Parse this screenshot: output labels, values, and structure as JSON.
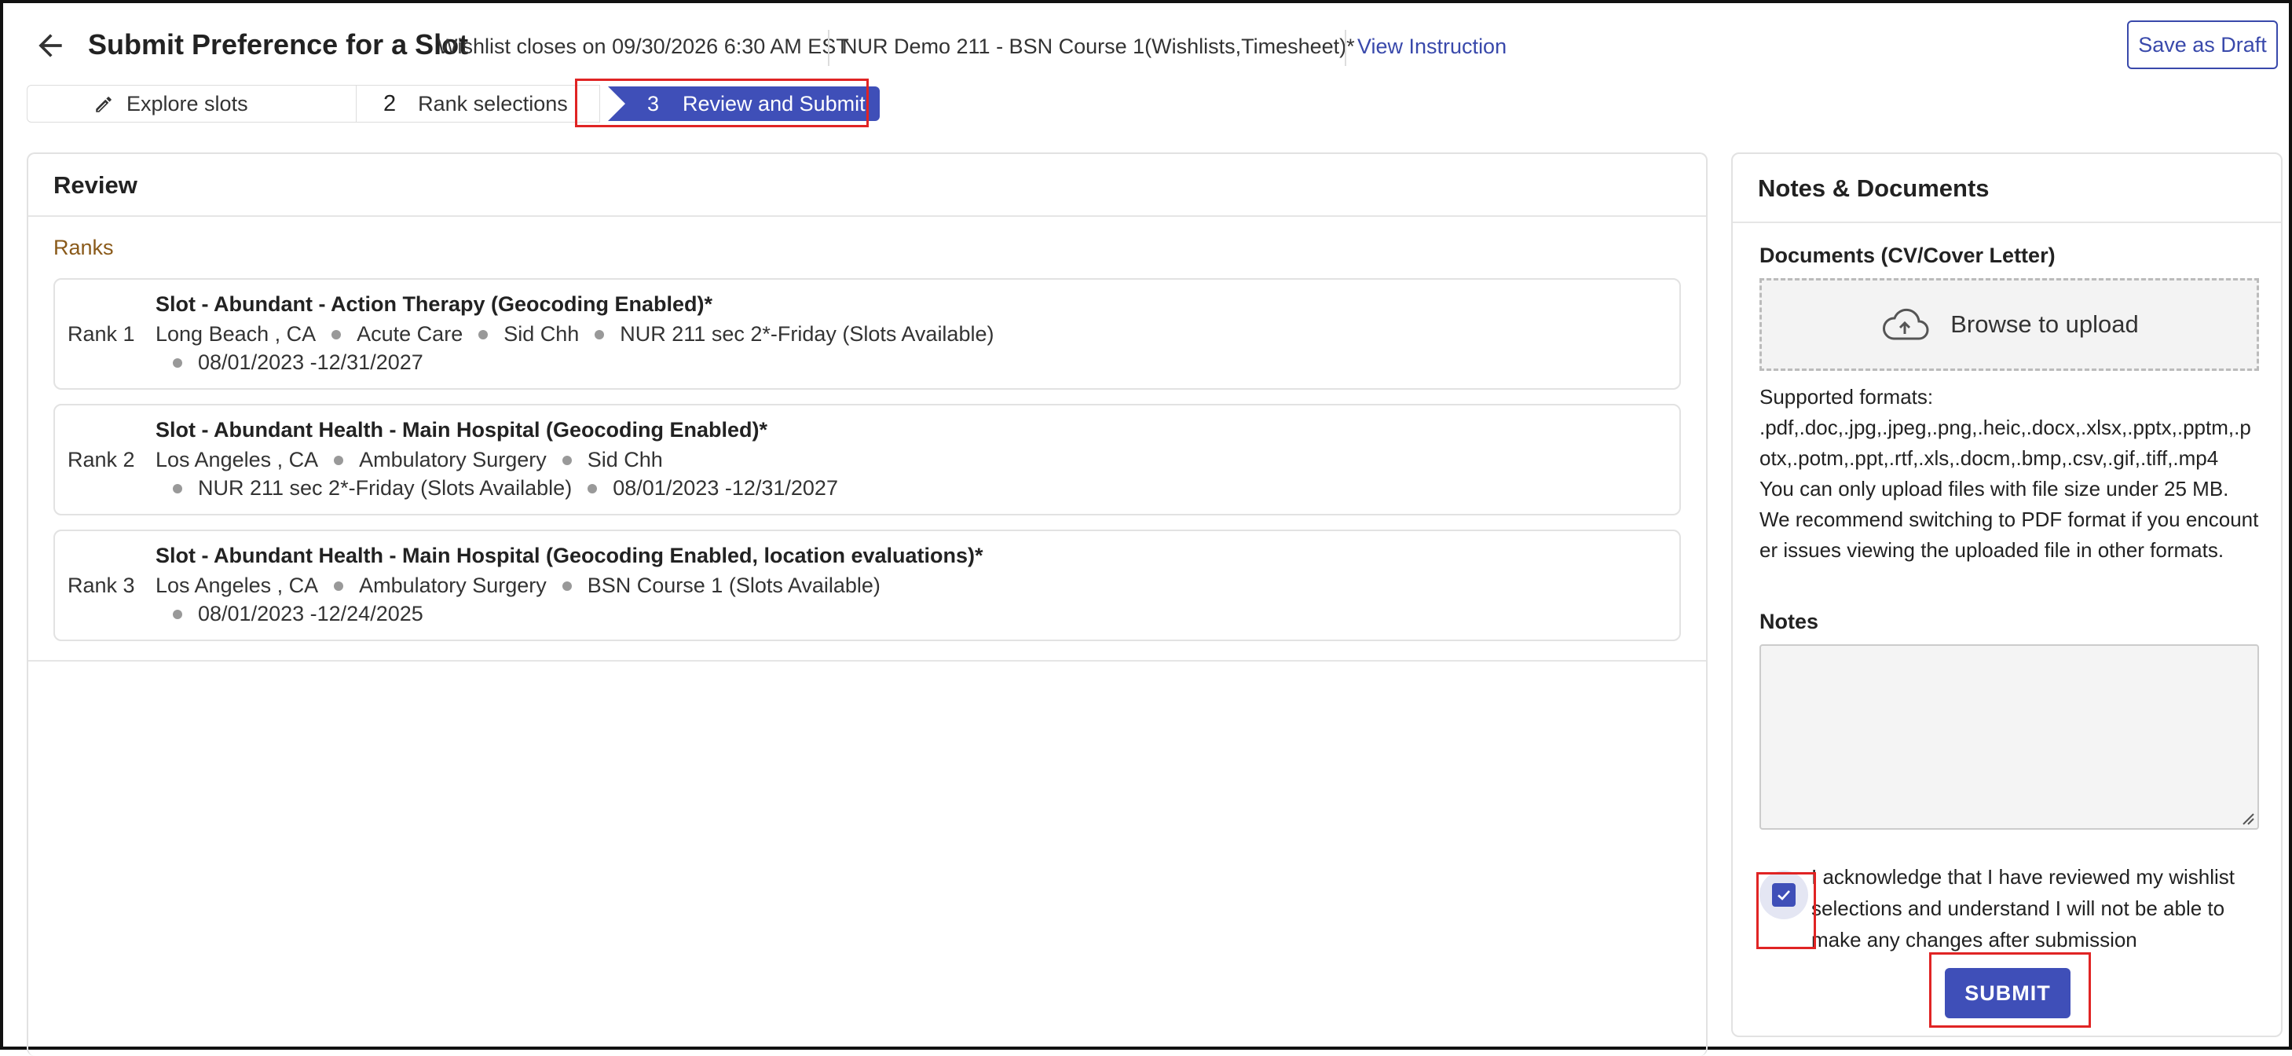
{
  "header": {
    "title": "Submit Preference for a Slot",
    "wishlist_close": "Wishlist closes on 09/30/2026 6:30 AM EST",
    "course_name": "NUR Demo 211 - BSN Course 1(Wishlists,Timesheet)*",
    "view_instruction": "View Instruction",
    "save_draft": "Save as Draft"
  },
  "stepper": {
    "steps": [
      {
        "number": "",
        "label": "Explore slots"
      },
      {
        "number": "2",
        "label": "Rank selections"
      },
      {
        "number": "3",
        "label": "Review and Submit"
      }
    ]
  },
  "review": {
    "title": "Review",
    "ranks_label": "Ranks",
    "ranks": [
      {
        "rank": "Rank 1",
        "title": "Slot - Abundant - Action Therapy (Geocoding Enabled)*",
        "line1": [
          "Long Beach , CA",
          "Acute Care",
          "Sid Chh",
          "NUR 211 sec 2*-Friday (Slots Available)"
        ],
        "line2": [
          "08/01/2023 -12/31/2027"
        ]
      },
      {
        "rank": "Rank 2",
        "title": "Slot - Abundant Health - Main Hospital (Geocoding Enabled)*",
        "line1": [
          "Los Angeles , CA",
          "Ambulatory Surgery",
          "Sid Chh"
        ],
        "line2": [
          "NUR 211 sec 2*-Friday (Slots Available)",
          "08/01/2023 -12/31/2027"
        ]
      },
      {
        "rank": "Rank 3",
        "title": "Slot - Abundant Health - Main Hospital (Geocoding Enabled, location evaluations)*",
        "line1": [
          "Los Angeles , CA",
          "Ambulatory Surgery",
          "BSN Course 1 (Slots Available)"
        ],
        "line2": [
          "08/01/2023 -12/24/2025"
        ]
      }
    ]
  },
  "notes": {
    "title": "Notes & Documents",
    "docs_label": "Documents (CV/Cover Letter)",
    "upload_text": "Browse to upload",
    "supported_label": "Supported formats:",
    "supported_formats": ".pdf,.doc,.jpg,.jpeg,.png,.heic,.docx,.xlsx,.pptx,.pptm,.potx,.potm,.ppt,.rtf,.xls,.docm,.bmp,.csv,.gif,.tiff,.mp4",
    "size_note": "You can only upload files with file size under 25 MB.",
    "pdf_note": "We recommend switching to PDF format if you encounter issues viewing the uploaded file in other formats.",
    "notes_label": "Notes",
    "notes_value": "",
    "ack_text": "I acknowledge that I have reviewed my wishlist selections and understand I will not be able to make any changes after submission",
    "ack_checked": true,
    "submit_label": "SUBMIT"
  },
  "colors": {
    "primary": "#3f4fb8",
    "ranks_label": "#8a5a1a",
    "highlight": "#e02424"
  }
}
